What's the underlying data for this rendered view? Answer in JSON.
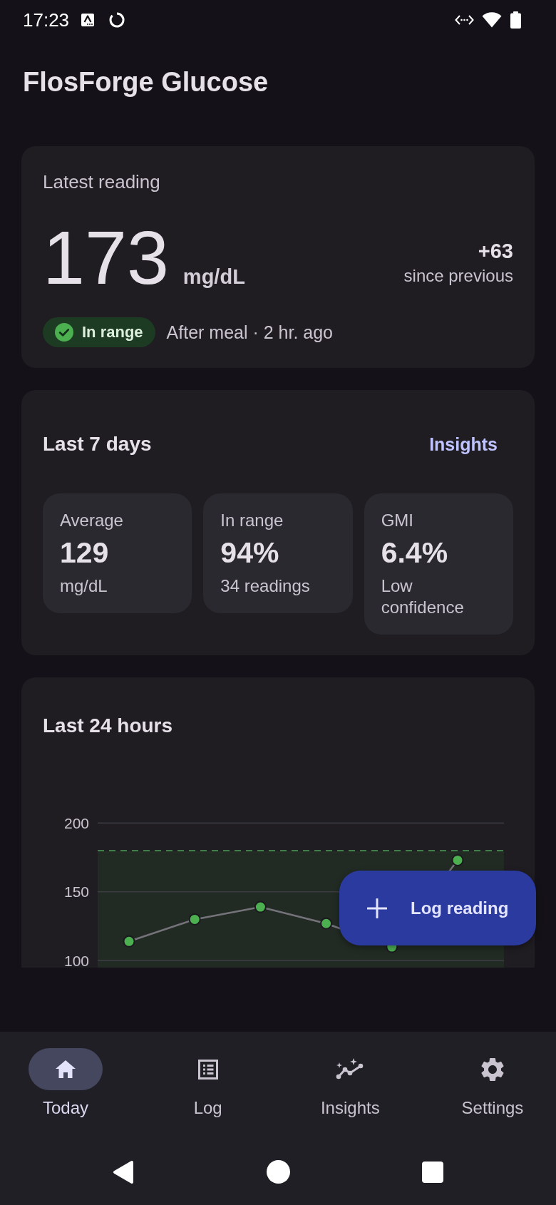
{
  "status_bar": {
    "time": "17:23"
  },
  "app_bar": {
    "title": "FlosForge Glucose"
  },
  "latest_reading": {
    "label": "Latest reading",
    "value": "173",
    "unit": "mg/dL",
    "change": "+63",
    "change_label": "since previous",
    "status": "In range",
    "context": "After meal · 2 hr. ago"
  },
  "summary": {
    "title": "Last 7 days",
    "link": "Insights",
    "stats": [
      {
        "label": "Average",
        "value": "129",
        "detail": "mg/dL"
      },
      {
        "label": "In range",
        "value": "94%",
        "detail": "34 readings"
      },
      {
        "label": "GMI",
        "value": "6.4%",
        "detail": "Low confidence"
      }
    ]
  },
  "trend": {
    "title": "Last 24 hours",
    "chart_data": {
      "type": "line",
      "categories": [
        null,
        null,
        null,
        null,
        null,
        null
      ],
      "ylim": [
        95,
        200
      ],
      "yticks": [
        100,
        150,
        200
      ],
      "grid": true,
      "series": [
        {
          "color": "#4caf50",
          "marker": "circle",
          "values": [
            114,
            130,
            139,
            127,
            110,
            173
          ]
        }
      ],
      "bands": [
        {
          "axis": "y",
          "from": 95,
          "to": 180
        }
      ],
      "ref_lines": [
        {
          "axis": "y",
          "value": 180
        }
      ]
    }
  },
  "fab": {
    "label": "Log reading"
  },
  "bottom_nav": {
    "items": [
      {
        "label": "Today",
        "selected": true
      },
      {
        "label": "Log",
        "selected": false
      },
      {
        "label": "Insights",
        "selected": false
      },
      {
        "label": "Settings",
        "selected": false
      }
    ]
  }
}
